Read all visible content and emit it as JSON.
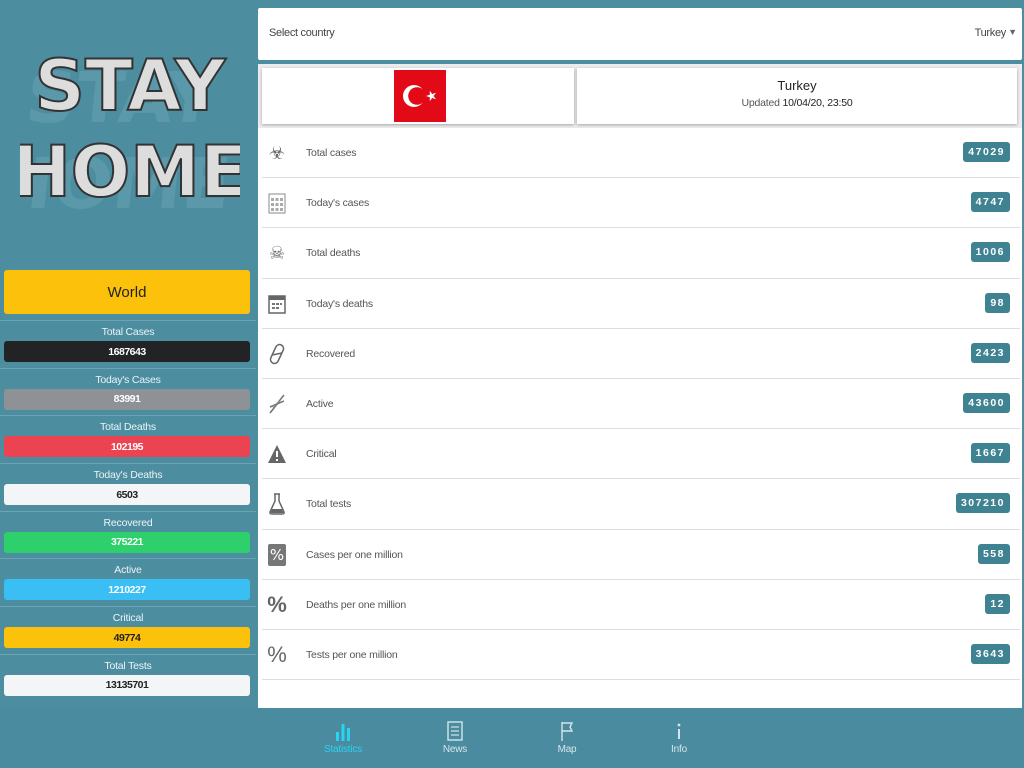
{
  "logo": {
    "line1": "STAY",
    "line2": "HOME"
  },
  "world": {
    "label": "World",
    "stats": [
      {
        "label": "Total Cases",
        "value": "1687643",
        "bg": "#222325",
        "fg": "#ffffff"
      },
      {
        "label": "Today's Cases",
        "value": "83991",
        "bg": "#8e9296",
        "fg": "#ffffff"
      },
      {
        "label": "Total Deaths",
        "value": "102195",
        "bg": "#ec4352",
        "fg": "#ffffff"
      },
      {
        "label": "Today's Deaths",
        "value": "6503",
        "bg": "#f3f5f7",
        "fg": "#222222"
      },
      {
        "label": "Recovered",
        "value": "375221",
        "bg": "#2ed06b",
        "fg": "#ffffff"
      },
      {
        "label": "Active",
        "value": "1210227",
        "bg": "#3abff5",
        "fg": "#ffffff"
      },
      {
        "label": "Critical",
        "value": "49774",
        "bg": "#fcc10a",
        "fg": "#222222"
      },
      {
        "label": "Total Tests",
        "value": "13135701",
        "bg": "#f3f5f7",
        "fg": "#222222"
      }
    ]
  },
  "selector": {
    "label": "Select country",
    "value": "Turkey"
  },
  "country": {
    "name": "Turkey",
    "updated_label": "Updated",
    "updated_date": "10/04/20, 23:50",
    "flag_colors": {
      "red": "#e30a17",
      "white": "#ffffff"
    },
    "stats": [
      {
        "label": "Total cases",
        "value": "47029",
        "icon": "biohazard-icon"
      },
      {
        "label": "Today's cases",
        "value": "4747",
        "icon": "calendar-grid-icon"
      },
      {
        "label": "Total deaths",
        "value": "1006",
        "icon": "skull-icon"
      },
      {
        "label": "Today's deaths",
        "value": "98",
        "icon": "calendar-icon"
      },
      {
        "label": "Recovered",
        "value": "2423",
        "icon": "pill-icon"
      },
      {
        "label": "Active",
        "value": "43600",
        "icon": "dna-icon"
      },
      {
        "label": "Critical",
        "value": "1667",
        "icon": "warning-icon"
      },
      {
        "label": "Total tests",
        "value": "307210",
        "icon": "flask-icon"
      },
      {
        "label": "Cases per one million",
        "value": "558",
        "icon": "percent-box-icon"
      },
      {
        "label": "Deaths per one million",
        "value": "12",
        "icon": "percent-icon"
      },
      {
        "label": "Tests per one million",
        "value": "3643",
        "icon": "percent-thin-icon"
      }
    ]
  },
  "nav": [
    {
      "label": "Statistics",
      "icon": "bar-chart-icon",
      "active": true
    },
    {
      "label": "News",
      "icon": "newspaper-icon",
      "active": false
    },
    {
      "label": "Map",
      "icon": "flag-icon",
      "active": false
    },
    {
      "label": "Info",
      "icon": "info-icon",
      "active": false
    }
  ],
  "colors": {
    "background": "#4d8da0",
    "badge": "#3f8392",
    "world_button": "#fcc10a",
    "nav_active": "#2ad3f2"
  }
}
